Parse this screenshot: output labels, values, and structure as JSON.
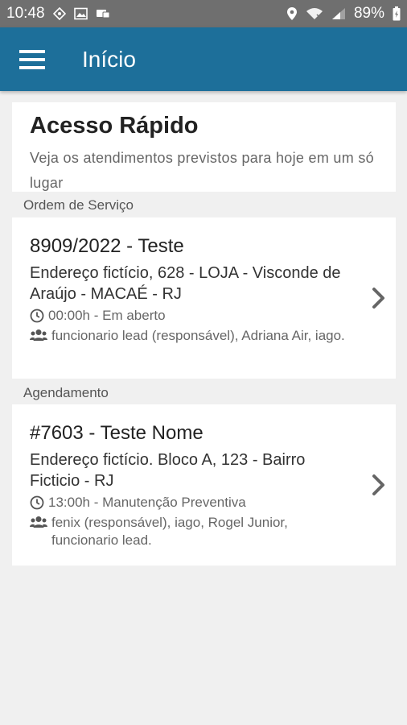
{
  "status_bar": {
    "time": "10:48",
    "battery": "89%"
  },
  "app_bar": {
    "title": "Início"
  },
  "quick_access": {
    "title": "Acesso Rápido",
    "description": "Veja os atendimentos previstos para hoje em um só lugar"
  },
  "sections": [
    {
      "label": "Ordem de Serviço",
      "item": {
        "title": "8909/2022 - Teste",
        "address": "Endereço fictício, 628 - LOJA - Visconde de Araújo - MACAÉ - RJ",
        "time_status": "00:00h  - Em aberto",
        "people": "funcionario lead (responsável), Adriana Air, iago."
      }
    },
    {
      "label": "Agendamento",
      "item": {
        "title": "#7603 - Teste Nome",
        "address": "Endereço fictício. Bloco A, 123 - Bairro Ficticio - RJ",
        "time_status": "13:00h  - Manutenção Preventiva",
        "people": "fenix (responsável), iago, Rogel Junior, funcionario lead."
      }
    }
  ],
  "icons": {
    "menu": "hamburger-menu-icon",
    "clock": "clock-icon",
    "people": "people-icon",
    "chevron": "chevron-right-icon"
  },
  "colors": {
    "app_bar": "#1d6f9a",
    "status_bar": "#6f6f6f",
    "background": "#f0f0f0"
  }
}
